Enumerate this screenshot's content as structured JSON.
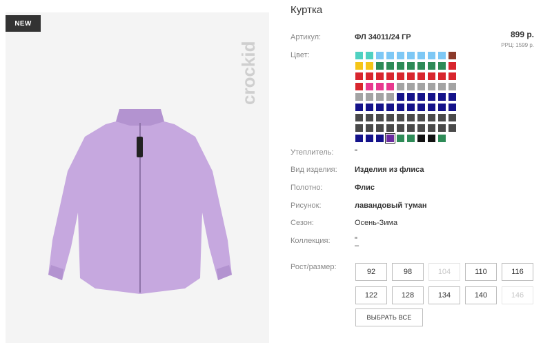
{
  "product": {
    "badge": "NEW",
    "brand": "crockid",
    "title": "Куртка",
    "price": "899 р.",
    "rrp": "РРЦ: 1599 р."
  },
  "attributes": {
    "article_label": "Артикул:",
    "article_value": "ФЛ 34011/24 ГР",
    "color_label": "Цвет:",
    "insulation_label": "Утеплитель:",
    "insulation_value": "\"",
    "type_label": "Вид изделия:",
    "type_value": "Изделия из флиса",
    "fabric_label": "Полотно:",
    "fabric_value": "Флис",
    "pattern_label": "Рисунок:",
    "pattern_value": "лавандовый туман",
    "season_label": "Сезон:",
    "season_value": "Осень-Зима",
    "collection_label": "Коллекция:",
    "collection_value_1": "\"",
    "collection_value_2": "–",
    "size_label": "Рост/размер:"
  },
  "swatches": [
    {
      "color": "#4fd1c1"
    },
    {
      "color": "#4fd1c1"
    },
    {
      "color": "#7ec8f5"
    },
    {
      "color": "#7ec8f5"
    },
    {
      "color": "#7ec8f5"
    },
    {
      "color": "#7ec8f5"
    },
    {
      "color": "#7ec8f5"
    },
    {
      "color": "#7ec8f5"
    },
    {
      "color": "#7ec8f5"
    },
    {
      "color": "#8b3a2b"
    },
    {
      "color": "#f5c518"
    },
    {
      "color": "#f5c518"
    },
    {
      "color": "#2e8b57"
    },
    {
      "color": "#2e8b57"
    },
    {
      "color": "#2e8b57"
    },
    {
      "color": "#2e8b57"
    },
    {
      "color": "#2e8b57"
    },
    {
      "color": "#2e8b57"
    },
    {
      "color": "#2e8b57"
    },
    {
      "color": "#d8262e"
    },
    {
      "color": "#d8262e"
    },
    {
      "color": "#d8262e"
    },
    {
      "color": "#d8262e"
    },
    {
      "color": "#d8262e"
    },
    {
      "color": "#d8262e"
    },
    {
      "color": "#d8262e"
    },
    {
      "color": "#d8262e"
    },
    {
      "color": "#d8262e"
    },
    {
      "color": "#d8262e"
    },
    {
      "color": "#d8262e"
    },
    {
      "color": "#d8262e"
    },
    {
      "color": "#e8388f"
    },
    {
      "color": "#e8388f"
    },
    {
      "color": "#e8388f"
    },
    {
      "color": "#a3a3a3"
    },
    {
      "color": "#a3a3a3"
    },
    {
      "color": "#a3a3a3"
    },
    {
      "color": "#a3a3a3"
    },
    {
      "color": "#a3a3a3"
    },
    {
      "color": "#a3a3a3"
    },
    {
      "color": "#a3a3a3"
    },
    {
      "color": "#a3a3a3"
    },
    {
      "color": "#a3a3a3"
    },
    {
      "color": "#a3a3a3"
    },
    {
      "color": "#14128a"
    },
    {
      "color": "#14128a"
    },
    {
      "color": "#14128a"
    },
    {
      "color": "#14128a"
    },
    {
      "color": "#14128a"
    },
    {
      "color": "#14128a"
    },
    {
      "color": "#14128a"
    },
    {
      "color": "#14128a"
    },
    {
      "color": "#14128a"
    },
    {
      "color": "#14128a"
    },
    {
      "color": "#14128a"
    },
    {
      "color": "#14128a"
    },
    {
      "color": "#14128a"
    },
    {
      "color": "#14128a"
    },
    {
      "color": "#14128a"
    },
    {
      "color": "#14128a"
    },
    {
      "color": "#4a4a4a"
    },
    {
      "color": "#4a4a4a"
    },
    {
      "color": "#4a4a4a"
    },
    {
      "color": "#4a4a4a"
    },
    {
      "color": "#4a4a4a"
    },
    {
      "color": "#4a4a4a"
    },
    {
      "color": "#4a4a4a"
    },
    {
      "color": "#4a4a4a"
    },
    {
      "color": "#4a4a4a"
    },
    {
      "color": "#4a4a4a"
    },
    {
      "color": "#4a4a4a"
    },
    {
      "color": "#4a4a4a"
    },
    {
      "color": "#4a4a4a"
    },
    {
      "color": "#4a4a4a"
    },
    {
      "color": "#4a4a4a"
    },
    {
      "color": "#4a4a4a"
    },
    {
      "color": "#4a4a4a"
    },
    {
      "color": "#4a4a4a"
    },
    {
      "color": "#4a4a4a"
    },
    {
      "color": "#4a4a4a"
    },
    {
      "color": "#14128a"
    },
    {
      "color": "#14128a"
    },
    {
      "color": "#14128a"
    },
    {
      "color": "#6a2ba0",
      "selected": true
    },
    {
      "color": "#2e8b57"
    },
    {
      "color": "#2e8b57"
    },
    {
      "color": "#111111"
    },
    {
      "color": "#111111"
    },
    {
      "color": "#2e8b57"
    }
  ],
  "sizes": [
    {
      "label": "92",
      "available": true
    },
    {
      "label": "98",
      "available": true
    },
    {
      "label": "104",
      "available": false
    },
    {
      "label": "110",
      "available": true
    },
    {
      "label": "116",
      "available": true
    },
    {
      "label": "122",
      "available": true
    },
    {
      "label": "128",
      "available": true
    },
    {
      "label": "134",
      "available": true
    },
    {
      "label": "140",
      "available": true
    },
    {
      "label": "146",
      "available": false
    }
  ],
  "select_all_label": "ВЫБРАТЬ ВСЕ",
  "colors": {
    "jacket": "#c6a8df",
    "jacket_shade": "#b393d0",
    "badge_bg": "#333333",
    "logo": "#cfcfcf"
  }
}
